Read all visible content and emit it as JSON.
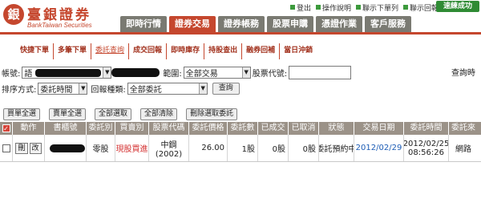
{
  "header": {
    "logo_mark": "銀",
    "logo_name": "臺銀證券",
    "logo_sub": "BankTaiwan Securities",
    "links": [
      "登出",
      "操作說明",
      "聯示下單列",
      "聯示回報"
    ],
    "easy_button": "速練成功",
    "nav_tabs": [
      "即時行情",
      "證券交易",
      "證券帳務",
      "股票申購",
      "憑證作業",
      "客戶服務"
    ]
  },
  "subnav": [
    "快捷下單",
    "多筆下單",
    "委託查詢",
    "成交回報",
    "即時庫存",
    "持股查出",
    "融券回補",
    "當日沖銷"
  ],
  "filters": {
    "account_label": "帳號:",
    "account_value": "語",
    "range_label": "範圍:",
    "range_value": "全部交易",
    "stock_code_label": "股票代號:",
    "stock_code_value": "",
    "query_time_label": "查詢時",
    "sort_label": "排序方式:",
    "sort_value": "委託時間",
    "return_type_label": "回報種類:",
    "return_type_value": "全部委託",
    "query_button": "查詢"
  },
  "actions": [
    "買單全選",
    "賣單全選",
    "全部選取",
    "全部清除",
    "刪除選取委託"
  ],
  "table": {
    "headers": [
      "✓",
      "動作",
      "書櫃號",
      "委託別",
      "買賣別",
      "股票代碼",
      "委託價格",
      "委託數",
      "已成交",
      "已取消",
      "狀態",
      "交易日期",
      "委託時間",
      "委託來"
    ],
    "rows": [
      {
        "action_delete": "刪",
        "action_modify": "改",
        "order_type": "零股",
        "side": "現股買進",
        "stock_name": "中鋼",
        "stock_code": "(2002)",
        "price": "26.00",
        "quantity": "1股",
        "filled": "0股",
        "cancelled": "0股",
        "status": "委託預約中",
        "trade_date": "2012/02/29",
        "order_date": "2012/02/25",
        "order_time": "08:56:26",
        "source": "網路"
      }
    ]
  },
  "colors": {
    "brand_red": "#c5472e",
    "nav_gray": "#7a7a72",
    "header_gray": "#9b9288",
    "green": "#2f8b34"
  }
}
